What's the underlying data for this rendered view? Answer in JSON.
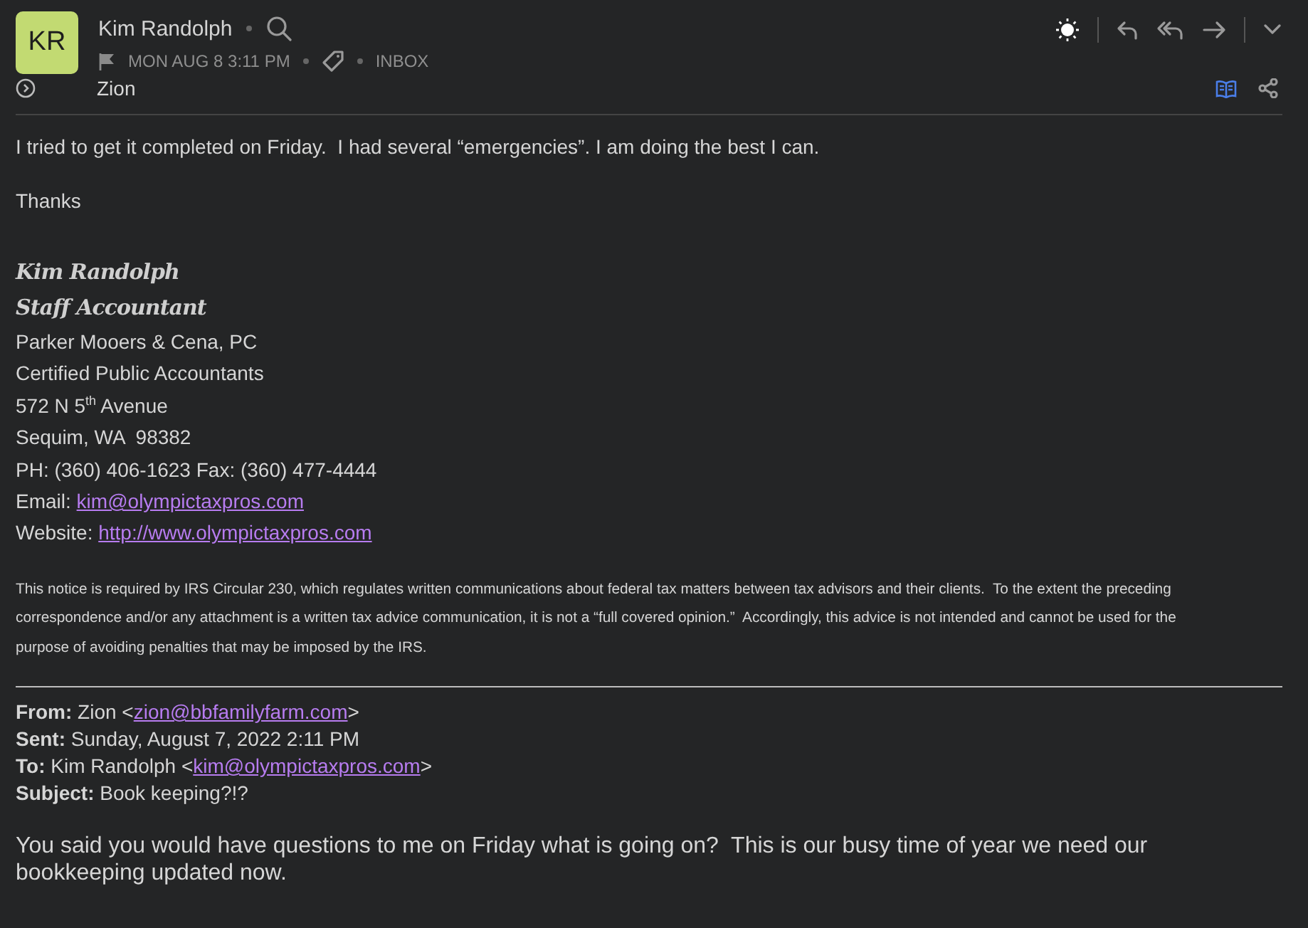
{
  "header": {
    "initials": "KR",
    "sender": "Kim Randolph",
    "date": "MON AUG 8 3:11 PM",
    "folder": "INBOX",
    "flagged": false,
    "recipient": "Zion"
  },
  "body": {
    "paragraphs": [
      "I tried to get it completed on Friday.  I had several “emergencies”. I am doing the best I can.",
      "Thanks"
    ],
    "signature_name": [
      "Kim Randolph",
      "Staff Accountant"
    ],
    "signature_lines": [
      {
        "text": "Parker Mooers & Cena, PC"
      },
      {
        "text": "Certified Public Accountants"
      },
      {
        "text": "572 N 5$^{th}$ Avenue"
      },
      {
        "text": "Sequim, WA  98382"
      },
      {
        "text": "PH: (360) 406-1623 Fax: (360) 477-4444"
      },
      {
        "text": "Email: ",
        "link": "kim@olympictaxpros.com"
      },
      {
        "text": "Website: ",
        "link": "http://www.olympictaxpros.com"
      }
    ],
    "notice": [
      "This notice is required by IRS Circular 230, which regulates written communications about federal tax matters between tax advisors and their clients.  To the extent the preceding",
      "correspondence and/or any attachment is a written tax advice communication, it is not a “full covered opinion.”  Accordingly, this advice is not intended and cannot be used for the",
      "purpose of avoiding penalties that may be imposed by the IRS."
    ]
  },
  "quoted": {
    "fields": [
      {
        "label": "From:",
        "before": " Zion <",
        "link": "zion@bbfamilyfarm.com",
        "after": ">"
      },
      {
        "label": "Sent:",
        "before": " Sunday, August 7, 2022 2:11 PM"
      },
      {
        "label": "To:",
        "before": " Kim Randolph <",
        "link": "kim@olympictaxpros.com",
        "after": ">"
      },
      {
        "label": "Subject:",
        "before": " Book keeping?!?"
      }
    ],
    "message": "You said you would have questions to me on Friday what is going on?  This is our busy time of year we need our bookkeeping updated now."
  }
}
